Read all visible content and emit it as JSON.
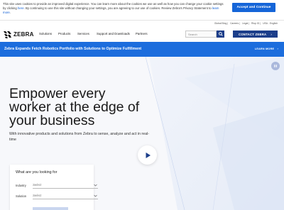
{
  "cookie": {
    "text_1": "This site uses cookies to provide an improved digital experience. You can learn more about the cookies we use as well as how you can change your cookie settings by clicking",
    "here_1": "here",
    "text_2": ". By continuing to use this site without changing your settings, you are agreeing to our use of cookies. Review Zebra's Privacy Statement to",
    "learn_more": "learn more",
    "accept_label": "Accept and Continue"
  },
  "utility": {
    "links": [
      "Global Blog",
      "Careers",
      "Legal",
      "Rlop ID",
      "USA - English"
    ]
  },
  "nav": {
    "brand": "ZEBRA",
    "items": [
      "Solutions",
      "Products",
      "Services",
      "Support and Downloads",
      "Partners"
    ],
    "search_placeholder": "Search",
    "contact_label": "CONTACT ZEBRA",
    "contact_arrow": "›"
  },
  "announcement": {
    "text": "Zebra Expands Fetch Robotics Portfolio with Solutions to Optimize Fulfillment",
    "link": "LEARN MORE",
    "link_arrow": "›"
  },
  "hero": {
    "headline": "Empower every worker at the edge of your business",
    "subtext": "With innovative products and solutions from Zebra to sense, analyze and act in real-time"
  },
  "form": {
    "title": "What are you looking for",
    "industry_label": "Industry",
    "industry_value": "Select",
    "solution_label": "Solution",
    "solution_value": "Select"
  },
  "colors": {
    "accent_blue": "#1c6ddd",
    "navy": "#1c3e8a",
    "cookie_button": "#1565d8"
  },
  "icons": [
    "zebra-logo-icon",
    "search-icon",
    "chat-icon",
    "play-icon",
    "chevron-down-icon"
  ]
}
